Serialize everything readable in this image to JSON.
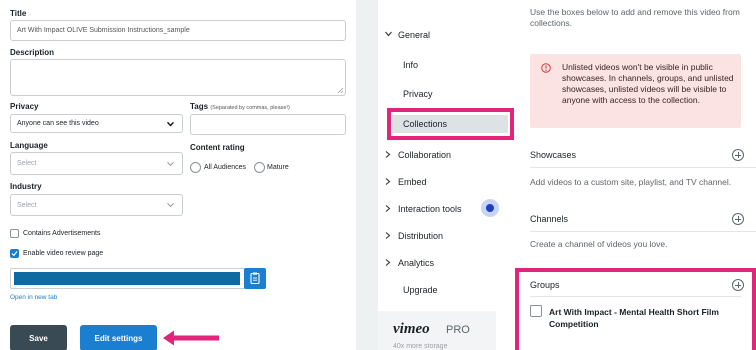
{
  "left": {
    "title_label": "Title",
    "title_value": "Art With Impact OLIVE Submission Instructions_sample",
    "description_label": "Description",
    "description_value": "",
    "privacy_label": "Privacy",
    "privacy_value": "Anyone can see this video",
    "tags_label": "Tags",
    "tags_hint": "(Separated by commas, please!)",
    "tags_value": "",
    "language_label": "Language",
    "language_value": "Select",
    "content_rating_label": "Content rating",
    "rating_all": "All Audiences",
    "rating_mature": "Mature",
    "industry_label": "Industry",
    "industry_value": "Select",
    "contains_ads_label": "Contains Advertisements",
    "enable_review_label": "Enable video review page",
    "open_new_tab": "Open in new tab",
    "save_label": "Save",
    "edit_settings_label": "Edit settings"
  },
  "nav": {
    "general": "General",
    "info": "Info",
    "privacy": "Privacy",
    "collections": "Collections",
    "collaboration": "Collaboration",
    "embed": "Embed",
    "interaction_tools": "Interaction tools",
    "distribution": "Distribution",
    "analytics": "Analytics",
    "upgrade": "Upgrade",
    "vimeo_brand": "vimeo",
    "vimeo_pro": "PRO",
    "vimeo_promo": "40x more storage"
  },
  "collections": {
    "intro": "Use the boxes below to add and remove this video from collections.",
    "warning": "Unlisted videos won't be visible in public showcases. In channels, groups, and unlisted showcases, unlisted videos will be visible to anyone with access to the collection.",
    "showcases_title": "Showcases",
    "showcases_desc": "Add videos to a custom site, playlist, and TV channel.",
    "channels_title": "Channels",
    "channels_desc": "Create a channel of videos you love.",
    "groups_title": "Groups",
    "group_item": "Art With Impact - Mental Health Short Film Competition"
  },
  "colors": {
    "accent_pink": "#e2247a",
    "button_blue": "#1a7fd1",
    "save_dark": "#3a4a55",
    "progress_bar": "#0f6aa1"
  }
}
